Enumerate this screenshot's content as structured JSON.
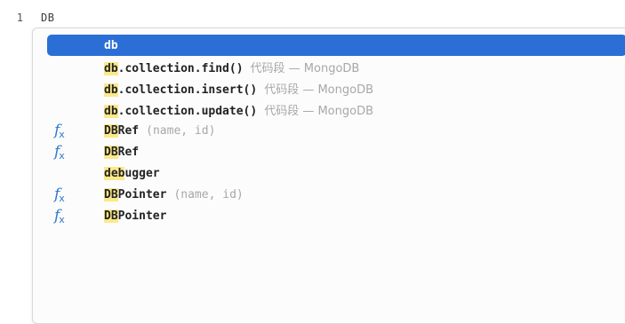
{
  "editor": {
    "line_number": "1",
    "line_text": "DB"
  },
  "suggestions": [
    {
      "match": "db",
      "rest": "",
      "detail": "",
      "icon": "",
      "selected": true
    },
    {
      "match": "db",
      "rest": ".collection.find()",
      "detail": "代码段 — MongoDB",
      "icon": "",
      "selected": false
    },
    {
      "match": "db",
      "rest": ".collection.insert()",
      "detail": "代码段 — MongoDB",
      "icon": "",
      "selected": false
    },
    {
      "match": "db",
      "rest": ".collection.update()",
      "detail": "代码段 — MongoDB",
      "icon": "",
      "selected": false
    },
    {
      "match": "DB",
      "rest": "Ref",
      "detail": "(name, id)",
      "icon": "function-icon",
      "selected": false
    },
    {
      "match": "DB",
      "rest": "Ref",
      "detail": "",
      "icon": "function-icon",
      "selected": false
    },
    {
      "match": "deb",
      "rest": "ugger",
      "detail": "",
      "icon": "",
      "selected": false
    },
    {
      "match": "DB",
      "rest": "Pointer",
      "detail": "(name, id)",
      "icon": "function-icon",
      "selected": false
    },
    {
      "match": "DB",
      "rest": "Pointer",
      "detail": "",
      "icon": "function-icon",
      "selected": false
    }
  ],
  "colors": {
    "selection": "#2b6fd6",
    "match_highlight": "#fbe98a",
    "function_icon": "#2f79d0",
    "detail_text": "#a8a8a8"
  }
}
